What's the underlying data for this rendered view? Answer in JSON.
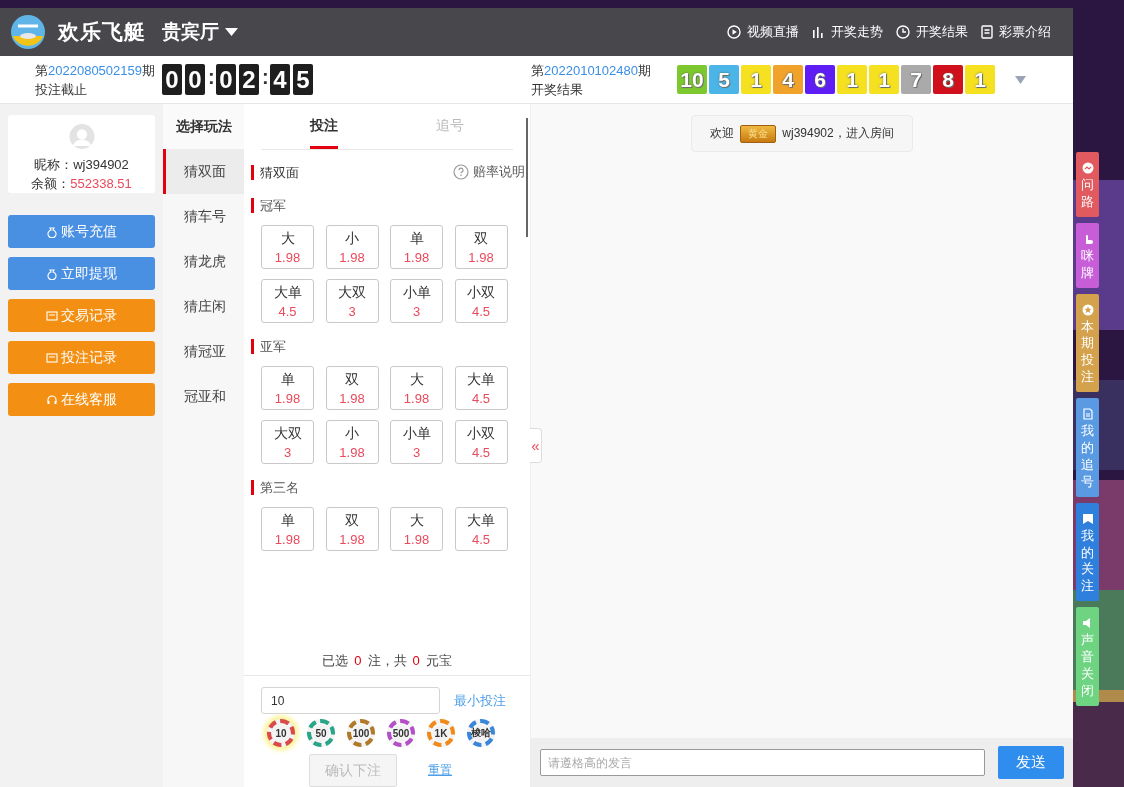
{
  "header": {
    "title": "欢乐飞艇",
    "hall": "贵宾厅",
    "nav": [
      {
        "kind": "video",
        "label": "视频直播"
      },
      {
        "kind": "trend",
        "label": "开奖走势"
      },
      {
        "kind": "results",
        "label": "开奖结果"
      },
      {
        "kind": "intro",
        "label": "彩票介绍"
      }
    ]
  },
  "current": {
    "prefix": "第",
    "issue": "2022080502159",
    "suffix": "期",
    "label": "投注截止",
    "countdown": [
      {
        "kind": "digit",
        "text": "0"
      },
      {
        "kind": "digit",
        "text": "0"
      },
      {
        "kind": "sep",
        "text": ":"
      },
      {
        "kind": "digit",
        "text": "0"
      },
      {
        "kind": "digit",
        "text": "2"
      },
      {
        "kind": "sep",
        "text": ":"
      },
      {
        "kind": "digit",
        "text": "4"
      },
      {
        "kind": "digit",
        "text": "5"
      }
    ]
  },
  "last_draw": {
    "prefix": "第",
    "issue": "2022010102480",
    "suffix": "期",
    "label": "开奖结果",
    "numbers": [
      {
        "text": "10",
        "color": "#7dc82e"
      },
      {
        "text": "5",
        "color": "#4ab5e6"
      },
      {
        "text": "1",
        "color": "#f5e11f"
      },
      {
        "text": "4",
        "color": "#f0a22a"
      },
      {
        "text": "6",
        "color": "#5e1df5"
      },
      {
        "text": "1",
        "color": "#f5e11f"
      },
      {
        "text": "1",
        "color": "#f5e11f"
      },
      {
        "text": "7",
        "color": "#aaaaaa"
      },
      {
        "text": "8",
        "color": "#d0101c"
      },
      {
        "text": "1",
        "color": "#f5e11f"
      }
    ]
  },
  "user": {
    "nickname_label": "昵称：",
    "nickname": "wj394902",
    "balance_label": "余额：",
    "balance": "552338.51"
  },
  "actions": [
    {
      "kind": "deposit",
      "label": "账号充值"
    },
    {
      "kind": "withdraw",
      "label": "立即提现"
    },
    {
      "kind": "transactions",
      "label": "交易记录"
    },
    {
      "kind": "bets",
      "label": "投注记录"
    },
    {
      "kind": "support",
      "label": "在线客服"
    }
  ],
  "play_menu": {
    "title": "选择玩法",
    "items": [
      {
        "label": "猜双面",
        "selected": true
      },
      {
        "label": "猜车号",
        "selected": false
      },
      {
        "label": "猜龙虎",
        "selected": false
      },
      {
        "label": "猜庄闲",
        "selected": false
      },
      {
        "label": "猜冠亚",
        "selected": false
      },
      {
        "label": "冠亚和",
        "selected": false
      }
    ]
  },
  "bet_panel": {
    "tabs": [
      {
        "label": "投注",
        "selected": true
      },
      {
        "label": "追号",
        "selected": false
      }
    ],
    "title": "猜双面",
    "odds_help": "赔率说明",
    "collapse": "«",
    "sections": [
      {
        "title": "冠军",
        "options": [
          {
            "label": "大",
            "odds": "1.98"
          },
          {
            "label": "小",
            "odds": "1.98"
          },
          {
            "label": "单",
            "odds": "1.98"
          },
          {
            "label": "双",
            "odds": "1.98"
          },
          {
            "label": "大单",
            "odds": "4.5"
          },
          {
            "label": "大双",
            "odds": "3"
          },
          {
            "label": "小单",
            "odds": "3"
          },
          {
            "label": "小双",
            "odds": "4.5"
          }
        ]
      },
      {
        "title": "亚军",
        "options": [
          {
            "label": "单",
            "odds": "1.98"
          },
          {
            "label": "双",
            "odds": "1.98"
          },
          {
            "label": "大",
            "odds": "1.98"
          },
          {
            "label": "大单",
            "odds": "4.5"
          },
          {
            "label": "大双",
            "odds": "3"
          },
          {
            "label": "小",
            "odds": "1.98"
          },
          {
            "label": "小单",
            "odds": "3"
          },
          {
            "label": "小双",
            "odds": "4.5"
          }
        ]
      },
      {
        "title": "第三名",
        "options": [
          {
            "label": "单",
            "odds": "1.98"
          },
          {
            "label": "双",
            "odds": "1.98"
          },
          {
            "label": "大",
            "odds": "1.98"
          },
          {
            "label": "大单",
            "odds": "4.5"
          }
        ]
      }
    ],
    "summary": {
      "prefix": "已选",
      "count": "0",
      "middle": "注，共",
      "amount": "0",
      "suffix": "元宝"
    },
    "amount": "10",
    "min_bet": "最小投注",
    "chips": [
      {
        "label": "10",
        "color": "#d94b4b",
        "selected": true
      },
      {
        "label": "50",
        "color": "#2aa58a",
        "selected": false
      },
      {
        "label": "100",
        "color": "#b07a2a",
        "selected": false
      },
      {
        "label": "500",
        "color": "#b44fc8",
        "selected": false
      },
      {
        "label": "1K",
        "color": "#f08a1c",
        "selected": false
      },
      {
        "label": "梭哈",
        "color": "#3a86d8",
        "selected": false
      }
    ],
    "confirm": "确认下注",
    "confirm_disabled": true,
    "reset": "重置"
  },
  "chat": {
    "welcome": {
      "prefix": "欢迎",
      "badge": "黄金",
      "text": "wj394902，进入房间"
    },
    "placeholder": "请遵格高的发言",
    "send": "发送"
  },
  "side_tabs": [
    {
      "kind": "route",
      "label": "问路",
      "color": "#e05a5f"
    },
    {
      "kind": "card",
      "label": "咪牌",
      "color": "#c75ed8"
    },
    {
      "kind": "current",
      "label": "本期投注",
      "color": "#d4a14c"
    },
    {
      "kind": "follow",
      "label": "我的追号",
      "color": "#5a9ae3"
    },
    {
      "kind": "bookmark",
      "label": "我的关注",
      "color": "#2f7fdd"
    },
    {
      "kind": "sound",
      "label": "声音关闭",
      "color": "#6fd482"
    }
  ]
}
